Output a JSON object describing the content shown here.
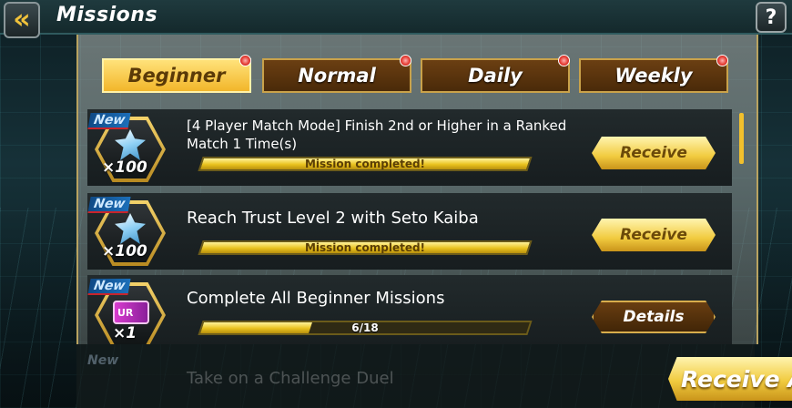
{
  "header": {
    "back_icon": "chevron-left-icon",
    "title": "Missions",
    "help_label": "?"
  },
  "tabs": [
    {
      "label": "Beginner",
      "active": true,
      "has_notification": true
    },
    {
      "label": "Normal",
      "active": false,
      "has_notification": true
    },
    {
      "label": "Daily",
      "active": false,
      "has_notification": true
    },
    {
      "label": "Weekly",
      "active": false,
      "has_notification": true
    }
  ],
  "missions": [
    {
      "new_label": "New",
      "reward_icon": "gem-icon",
      "reward_qty": "×100",
      "text": "[4 Player Match Mode] Finish 2nd or Higher in a Ranked Match 1 Time(s)",
      "progress_label": "Mission completed!",
      "progress": 1.0,
      "button_label": "Receive"
    },
    {
      "new_label": "New",
      "reward_icon": "gem-icon",
      "reward_qty": "×100",
      "text": "Reach Trust Level 2 with Seto Kaiba",
      "progress_label": "Mission completed!",
      "progress": 1.0,
      "button_label": "Receive"
    },
    {
      "new_label": "New",
      "reward_icon": "ur-ticket-icon",
      "reward_badge": "UR",
      "reward_qty": "×1",
      "text": "Complete All Beginner Missions",
      "progress_label": "6/18",
      "progress": 0.333,
      "button_label": "Details"
    }
  ],
  "partial_row": {
    "new_label": "New",
    "text": "Take on a Challenge Duel"
  },
  "receive_all_label": "Receive A",
  "colors": {
    "gold": "#f1cb3f",
    "tab_brown": "#6b3f12",
    "notification_red": "#e2352b"
  }
}
